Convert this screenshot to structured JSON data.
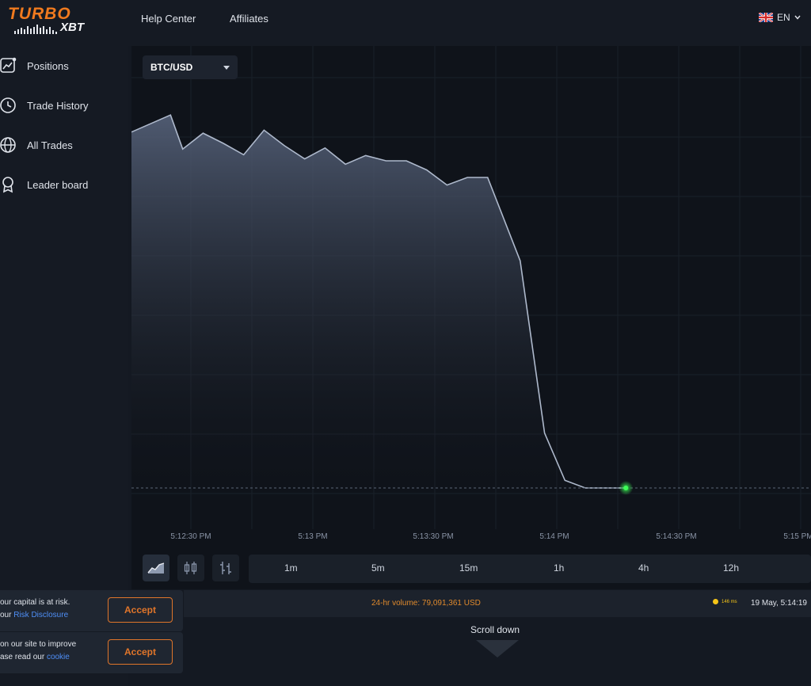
{
  "header": {
    "logo_top": "TURBO",
    "logo_bottom": "XBT",
    "nav": [
      "Help Center",
      "Affiliates"
    ],
    "language": "EN",
    "language_flag": "uk-flag-icon"
  },
  "sidebar": {
    "items": [
      {
        "label": "Positions",
        "icon": "chart-line-icon"
      },
      {
        "label": "Trade History",
        "icon": "clock-icon"
      },
      {
        "label": "All Trades",
        "icon": "globe-icon"
      },
      {
        "label": "Leader board",
        "icon": "award-icon"
      }
    ]
  },
  "chart": {
    "pair": "BTC/USD",
    "x_tick_labels": [
      "5:12:30 PM",
      "5:13 PM",
      "5:13:30 PM",
      "5:14 PM",
      "5:14:30 PM",
      "5:15 PM"
    ],
    "line_color": "#aeb9cc",
    "current_point_color": "#3dff57"
  },
  "chart_data": {
    "type": "area",
    "x": [
      "5:12:22",
      "5:12:25",
      "5:12:28",
      "5:12:33",
      "5:12:38",
      "5:12:43",
      "5:12:48",
      "5:12:53",
      "5:12:58",
      "5:13:03",
      "5:13:08",
      "5:13:13",
      "5:13:18",
      "5:13:23",
      "5:13:28",
      "5:13:33",
      "5:13:38",
      "5:13:43",
      "5:13:51",
      "5:13:57",
      "5:14:02",
      "5:14:07",
      "5:14:12",
      "5:14:17"
    ],
    "values": [
      0.94,
      0.985,
      0.895,
      0.937,
      0.91,
      0.88,
      0.945,
      0.904,
      0.869,
      0.898,
      0.855,
      0.878,
      0.864,
      0.864,
      0.84,
      0.8,
      0.82,
      0.82,
      0.6,
      0.145,
      0.02,
      0.0,
      0.0,
      0.0
    ],
    "xlabel": "",
    "ylabel": "",
    "grid": true
  },
  "tools": [
    "area-chart-icon",
    "candlestick-icon",
    "bar-chart-icon"
  ],
  "timeframes": [
    "1m",
    "5m",
    "15m",
    "1h",
    "4h",
    "12h"
  ],
  "status": {
    "volume": "24-hr volume: 79,091,361 USD",
    "ping": "146 ms",
    "datetime": "19 May, 5:14:19"
  },
  "notices": [
    {
      "text1": "our capital is at risk.",
      "text2_prefix": "our ",
      "link": "Risk Disclosure",
      "button": "Accept"
    },
    {
      "text1": "on our site to improve",
      "text2_prefix": "ase read our ",
      "link": "cookie",
      "button": "Accept"
    }
  ],
  "scroll_label": "Scroll down"
}
